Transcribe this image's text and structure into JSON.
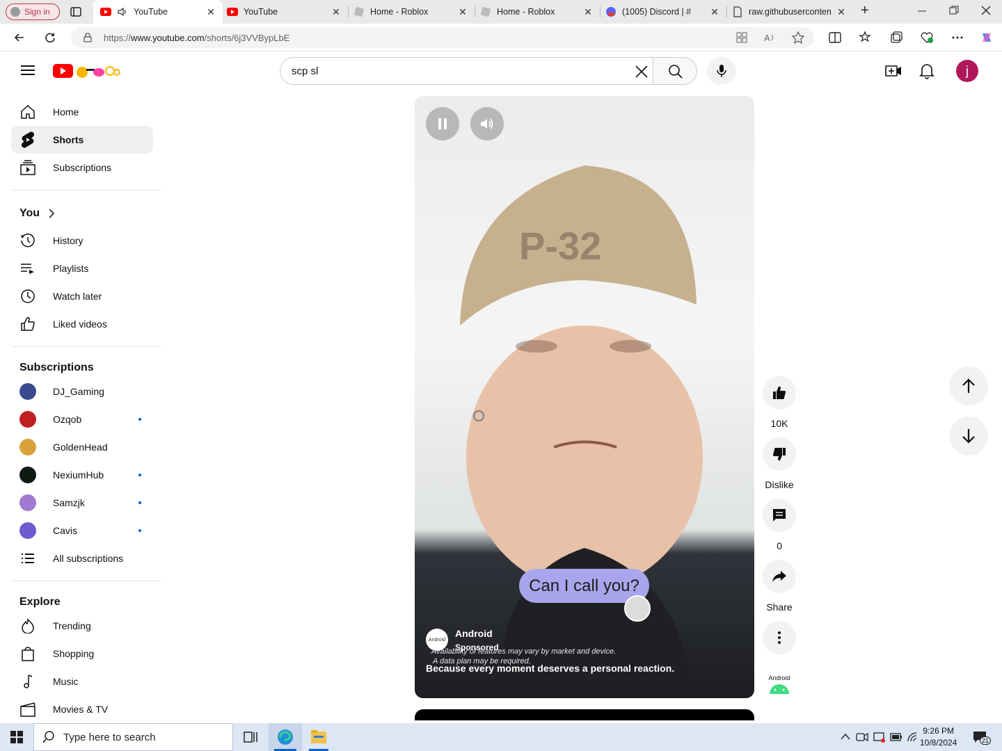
{
  "browser": {
    "signin_label": "Sign in",
    "tabs": [
      {
        "title": "YouTube",
        "close": "✕"
      },
      {
        "title": "YouTube",
        "close": "✕"
      },
      {
        "title": "Home - Roblox",
        "close": "✕"
      },
      {
        "title": "Home - Roblox",
        "close": "✕"
      },
      {
        "title": "(1005) Discord | #",
        "close": "✕"
      },
      {
        "title": "raw.githubuserconten",
        "close": "✕"
      }
    ],
    "new_tab": "+",
    "url_prefix": "https://",
    "url_host": "www.youtube.com",
    "url_path": "/shorts/6j3VVBypLbE"
  },
  "header": {
    "search_query": "scp sl",
    "avatar_letter": "j"
  },
  "sidebar": {
    "main": [
      {
        "label": "Home",
        "icon": "home-icon"
      },
      {
        "label": "Shorts",
        "icon": "shorts-icon"
      },
      {
        "label": "Subscriptions",
        "icon": "subscriptions-icon"
      }
    ],
    "you_heading": "You",
    "you": [
      {
        "label": "History",
        "icon": "history-icon"
      },
      {
        "label": "Playlists",
        "icon": "playlists-icon"
      },
      {
        "label": "Watch later",
        "icon": "watch-later-icon"
      },
      {
        "label": "Liked videos",
        "icon": "liked-videos-icon"
      }
    ],
    "subs_heading": "Subscriptions",
    "subs": [
      {
        "label": "DJ_Gaming",
        "color": "#3b4a8c",
        "dot": false
      },
      {
        "label": "Ozqob",
        "color": "#c0201f",
        "dot": true
      },
      {
        "label": "GoldenHead",
        "color": "#d9a23a",
        "dot": false
      },
      {
        "label": "NexiumHub",
        "color": "#0d1a12",
        "dot": true
      },
      {
        "label": "Samzjk",
        "color": "#a07ad0",
        "dot": true
      },
      {
        "label": "Cavis",
        "color": "#6d5bd0",
        "dot": true
      }
    ],
    "all_subs": "All subscriptions",
    "explore_heading": "Explore",
    "explore": [
      {
        "label": "Trending",
        "icon": "trending-icon"
      },
      {
        "label": "Shopping",
        "icon": "shopping-icon"
      },
      {
        "label": "Music",
        "icon": "music-icon"
      },
      {
        "label": "Movies & TV",
        "icon": "movies-icon"
      }
    ]
  },
  "short": {
    "bubble_text": "Can I call you?",
    "advertiser_logo_text": "Android",
    "advertiser": "Android",
    "sponsored": "Sponsored",
    "disclaimer_1": "Availability of features may vary by market and device.",
    "disclaimer_2": "A data plan may be required.",
    "caption": "Because every moment deserves a personal reaction."
  },
  "actions": {
    "likes": "10K",
    "dislike": "Dislike",
    "comments": "0",
    "share": "Share",
    "channel_logo_text": "Android"
  },
  "taskbar": {
    "search_placeholder": "Type here to search",
    "time": "9:26 PM",
    "date": "10/8/2024",
    "notifications": "21"
  }
}
